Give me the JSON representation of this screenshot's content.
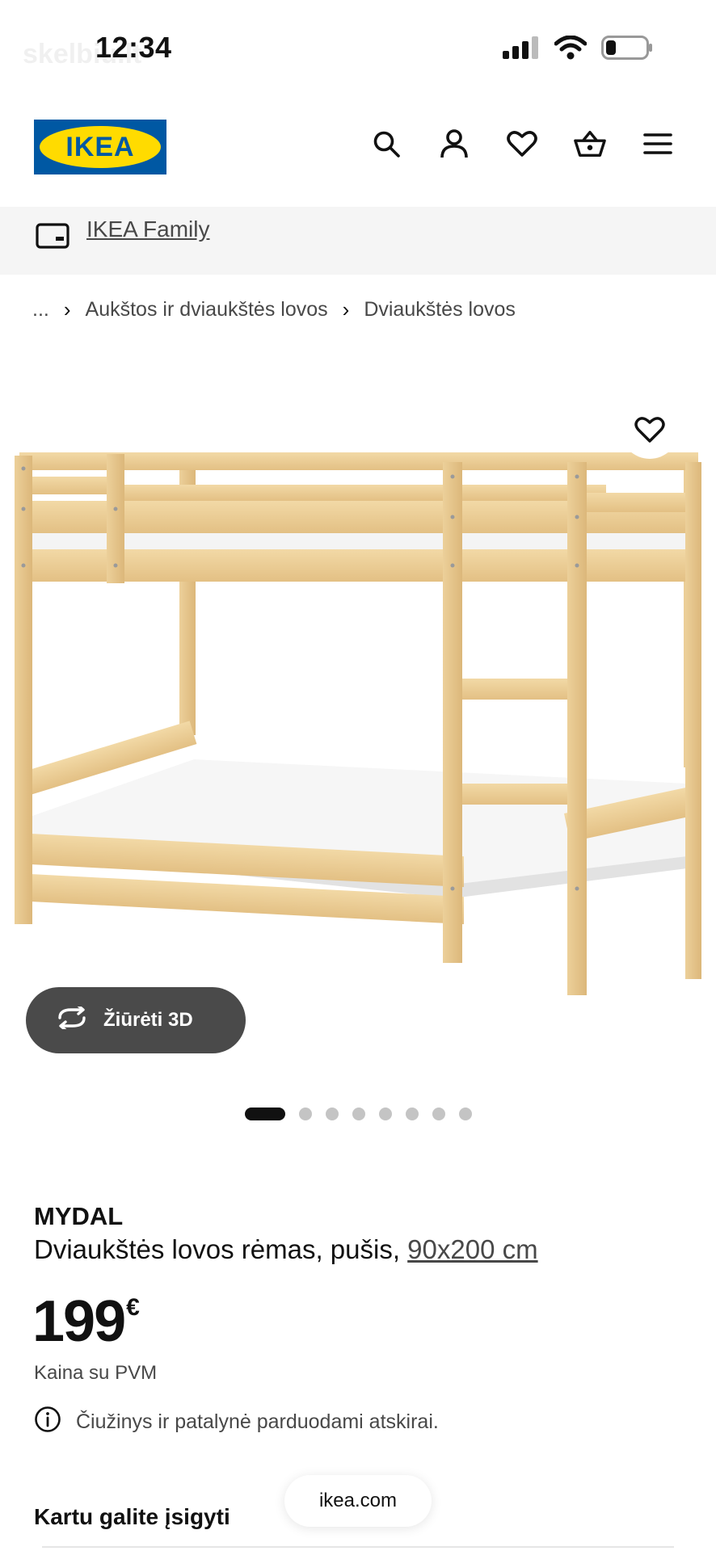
{
  "status_bar": {
    "time": "12:34",
    "watermark": "skelbiu.lt",
    "icons": [
      "signal-icon",
      "wifi-icon",
      "battery-icon"
    ]
  },
  "header": {
    "logo_text": "IKEA",
    "icons": [
      "search-icon",
      "account-icon",
      "heart-icon",
      "basket-icon",
      "menu-icon"
    ],
    "brand_colors": {
      "blue": "#0058a3",
      "yellow": "#ffdb00"
    }
  },
  "family": {
    "label": "IKEA Family",
    "icon": "card-icon"
  },
  "breadcrumb": {
    "items": [
      "...",
      "Aukštos ir dviaukštės lovos",
      "Dviaukštės lovos"
    ]
  },
  "gallery": {
    "view3d_label": "Žiūrėti 3D",
    "dot_count": 8,
    "active_dot": 1,
    "favorite_icon": "heart-icon"
  },
  "product": {
    "name": "MYDAL",
    "description": "Dviaukštės lovos rėmas, pušis,",
    "size": "90x200 cm",
    "price": "199",
    "currency": "€",
    "vat_note": "Kaina su PVM",
    "notice": "Čiužinys ir patalynė parduodami atskirai."
  },
  "buy_together": {
    "title": "Kartu galite įsigyti"
  },
  "browser": {
    "url": "ikea.com"
  }
}
